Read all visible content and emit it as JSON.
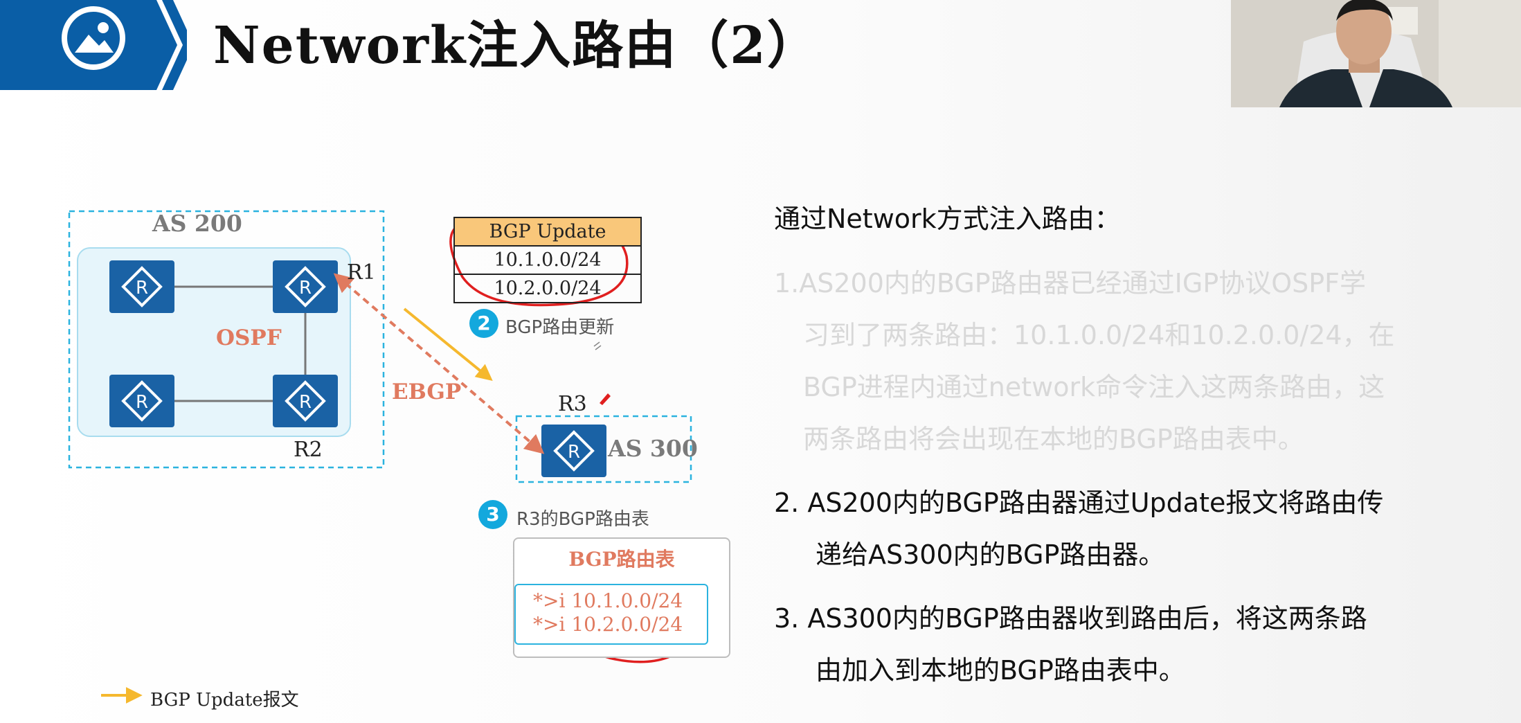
{
  "title": "Network注入路由（2）",
  "colors": {
    "brand_blue": "#0a5ea6",
    "router_blue": "#1a62a5",
    "accent_orange": "#f5b82e",
    "ebgp_red": "#e07a5f",
    "step_cyan": "#13a8dd",
    "annotation_red": "#e01f1f"
  },
  "logo": {
    "icon": "image-icon"
  },
  "diagram": {
    "as200_label": "AS 200",
    "ospf_label": "OSPF",
    "ebgp_label": "EBGP",
    "as300_label": "AS 300",
    "routers": {
      "r1": "R1",
      "r2": "R2",
      "r3": "R3",
      "icon_letter": "R"
    },
    "update_table": {
      "header": "BGP Update",
      "rows": [
        "10.1.0.0/24",
        "10.2.0.0/24"
      ]
    },
    "step2": {
      "number": "2",
      "text": "BGP路由更新"
    },
    "step3": {
      "number": "3",
      "text": "R3的BGP路由表"
    },
    "route_table": {
      "title": "BGP路由表",
      "rows": [
        {
          "flag": "*>i",
          "prefix": "10.1.0.0/24"
        },
        {
          "flag": "*>i",
          "prefix": "10.2.0.0/24"
        }
      ]
    },
    "legend": {
      "text": "BGP Update报文"
    }
  },
  "content": {
    "intro": "通过Network方式注入路由：",
    "point1": [
      "1.AS200内的BGP路由器已经通过IGP协议OSPF学",
      "习到了两条路由：10.1.0.0/24和10.2.0.0/24，在",
      "BGP进程内通过network命令注入这两条路由，这",
      "两条路由将会出现在本地的BGP路由表中。"
    ],
    "point2": [
      "2.  AS200内的BGP路由器通过Update报文将路由传",
      "递给AS300内的BGP路由器。"
    ],
    "point3": [
      "3.  AS300内的BGP路由器收到路由后，将这两条路",
      "由加入到本地的BGP路由表中。"
    ]
  }
}
